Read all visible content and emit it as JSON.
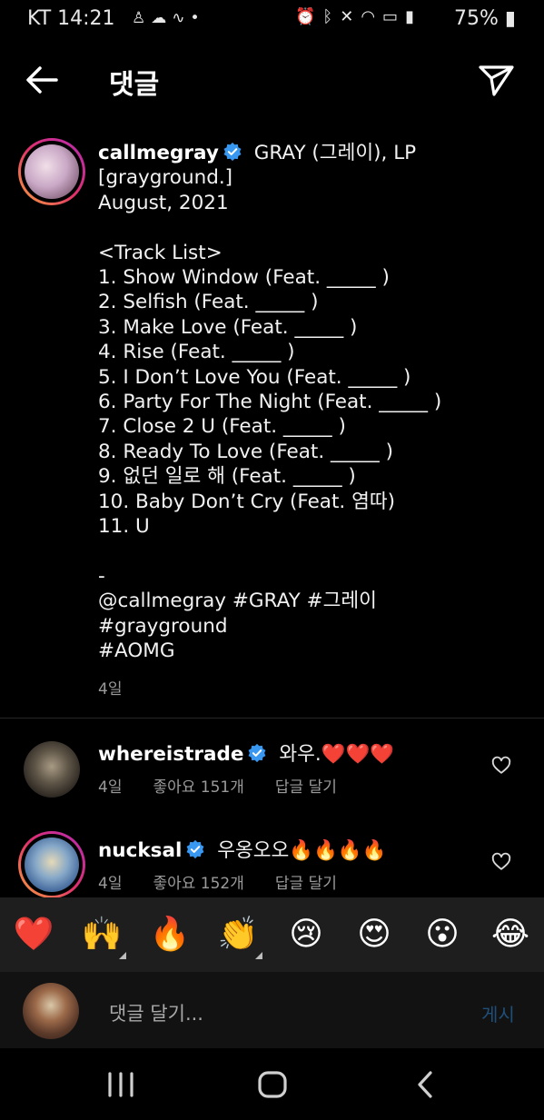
{
  "status_bar": {
    "carrier_time": "KT 14:21",
    "battery": "75%",
    "left_icons": [
      "notification-icon",
      "weather-icon",
      "signal-wave-icon",
      "dot-icon"
    ],
    "right_icons": [
      "alarm-icon",
      "bluetooth-icon",
      "mute-icon",
      "wifi-icon",
      "hd-icon",
      "cell-signal-icon",
      "battery-icon"
    ]
  },
  "header": {
    "title": "댓글"
  },
  "caption": {
    "username": "callmegray",
    "first_line": "GRAY (그레이), LP",
    "body": "[grayground.]\nAugust, 2021\n\n<Track List>\n1. Show Window (Feat. _____ )\n2. Selfish (Feat. _____ )\n3. Make Love (Feat. _____ )\n4. Rise (Feat. _____ )\n5. I Don’t Love You (Feat. _____ )\n6. Party For The Night (Feat. _____ )\n7. Close 2 U (Feat. _____ )\n8. Ready To Love (Feat. _____ )\n9. 없던 일로 해 (Feat. _____ )\n10. Baby Don’t Cry (Feat. 염따)\n11. U\n\n-\n@callmegray #GRAY #그레이\n#grayground\n#AOMG",
    "time_ago": "4일"
  },
  "comments": [
    {
      "username": "whereistrade",
      "text": "와우.❤️❤️❤️",
      "time": "4일",
      "likes": "좋아요 151개",
      "reply": "답글 달기"
    },
    {
      "username": "nucksal",
      "text": "우옹오오🔥🔥🔥🔥",
      "time": "4일",
      "likes": "좋아요 152개",
      "reply": "답글 달기"
    }
  ],
  "emoji_bar": [
    "❤️",
    "🙌",
    "🔥",
    "👏",
    "😢",
    "😍",
    "😮",
    "😂"
  ],
  "comment_input": {
    "placeholder": "댓글 달기...",
    "post_label": "게시"
  },
  "colors": {
    "background": "#000000",
    "verified_blue": "#3897f0",
    "secondary_text": "#9a9a9a",
    "post_button_disabled": "#1f4f78"
  }
}
